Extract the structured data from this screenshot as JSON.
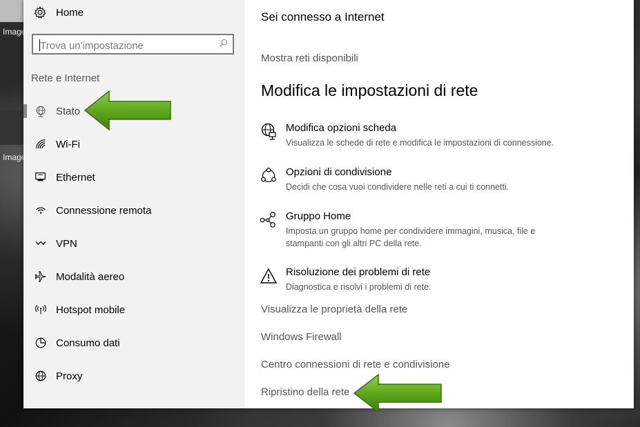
{
  "desktop": {
    "labels": [
      "Image",
      "Image"
    ]
  },
  "sidebar": {
    "home_label": "Home",
    "search_placeholder": "Trova un'impostazione",
    "section_title": "Rete e Internet",
    "items": [
      {
        "label": "Stato",
        "icon": "globe-icon",
        "selected": true
      },
      {
        "label": "Wi-Fi",
        "icon": "wifi-icon"
      },
      {
        "label": "Ethernet",
        "icon": "ethernet-icon"
      },
      {
        "label": "Connessione remota",
        "icon": "dialup-icon"
      },
      {
        "label": "VPN",
        "icon": "vpn-icon"
      },
      {
        "label": "Modalità aereo",
        "icon": "airplane-icon"
      },
      {
        "label": "Hotspot mobile",
        "icon": "hotspot-icon"
      },
      {
        "label": "Consumo dati",
        "icon": "data-usage-icon"
      },
      {
        "label": "Proxy",
        "icon": "globe-icon"
      }
    ]
  },
  "main": {
    "status_text": "Sei connesso a Internet",
    "show_networks_link": "Mostra reti disponibili",
    "heading": "Modifica le impostazioni di rete",
    "options": [
      {
        "title": "Modifica opzioni scheda",
        "desc": "Visualizza le schede di rete e modifica le impostazioni di connessione.",
        "icon": "adapter-globe-icon"
      },
      {
        "title": "Opzioni di condivisione",
        "desc": "Decidi che cosa vuoi condividere nelle reti a cui ti connetti.",
        "icon": "sharing-icon"
      },
      {
        "title": "Gruppo Home",
        "desc": "Imposta un gruppo home per condividere immagini, musica, file e stampanti con gli altri PC della rete.",
        "icon": "homegroup-icon"
      },
      {
        "title": "Risoluzione dei problemi di rete",
        "desc": "Diagnostica e risolvi i problemi di rete.",
        "icon": "warning-icon"
      }
    ],
    "links": [
      "Visualizza le proprietà della rete",
      "Windows Firewall",
      "Centro connessioni di rete e condivisione",
      "Ripristino della rete"
    ]
  },
  "colors": {
    "arrow_green": "#6aae1f",
    "sidebar_bg": "#f2f2f2",
    "link_gray": "#555555"
  }
}
